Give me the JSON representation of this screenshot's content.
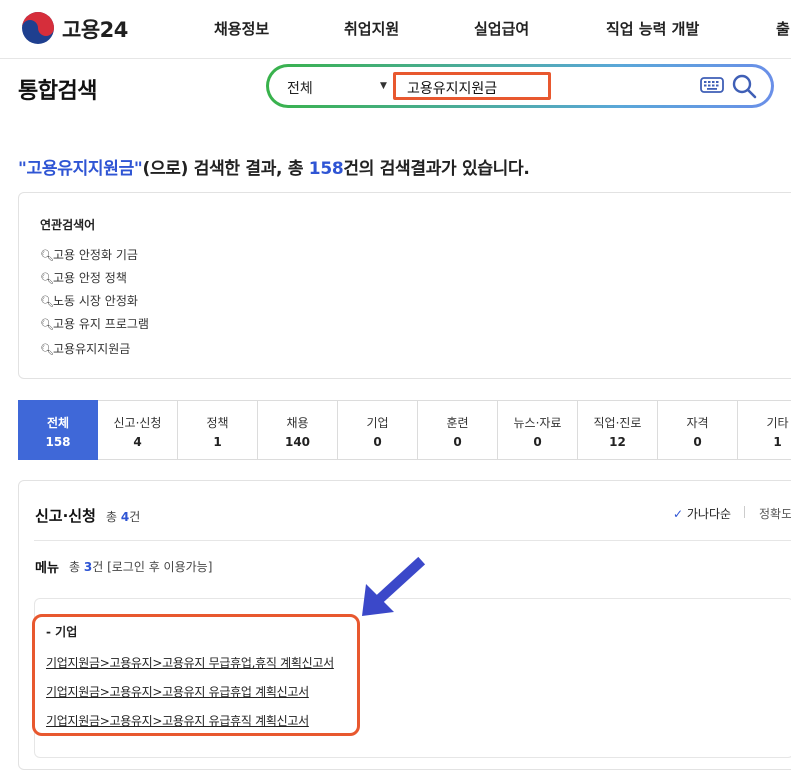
{
  "header": {
    "logo_text": "고용24",
    "nav": [
      "채용정보",
      "취업지원",
      "실업급여",
      "직업 능력 개발",
      "출"
    ]
  },
  "search": {
    "page_title": "통합검색",
    "scope": "전체",
    "query": "고용유지지원금"
  },
  "result": {
    "query_quoted": "\"고용유지지원금\"",
    "text1": "(으로) 검색한 결과, 총 ",
    "total": "158",
    "text2": "건의 검색결과가 있습니다."
  },
  "related": {
    "title": "연관검색어",
    "items": [
      "고용 안정화 기금",
      "고용 안정 정책",
      "노동 시장 안정화",
      "고용 유지 프로그램",
      "고용유지지원금"
    ]
  },
  "tabs": [
    {
      "label": "전체",
      "count": "158",
      "active": true
    },
    {
      "label": "신고·신청",
      "count": "4"
    },
    {
      "label": "정책",
      "count": "1"
    },
    {
      "label": "채용",
      "count": "140"
    },
    {
      "label": "기업",
      "count": "0"
    },
    {
      "label": "훈련",
      "count": "0"
    },
    {
      "label": "뉴스·자료",
      "count": "0"
    },
    {
      "label": "직업·진로",
      "count": "12"
    },
    {
      "label": "자격",
      "count": "0"
    },
    {
      "label": "기타",
      "count": "1"
    }
  ],
  "section": {
    "title": "신고·신청",
    "count_prefix": "총 ",
    "count": "4",
    "count_suffix": "건",
    "sort_active": "가나다순",
    "sort_other": "정확도"
  },
  "menu": {
    "title": "메뉴",
    "count_prefix": "총 ",
    "count": "3",
    "count_suffix": "건 [로그인 후 이용가능]",
    "company_label": "- 기업",
    "links": [
      "기업지원금>고용유지>고용유지 무급휴업,휴직 계획신고서",
      "기업지원금>고용유지>고용유지 유급휴업 계획신고서",
      "기업지원금>고용유지>고용유지 유급휴직 계획신고서"
    ]
  },
  "colors": {
    "accent": "#3f68d8",
    "highlight": "#e8582f",
    "arrow": "#3b48c9"
  }
}
